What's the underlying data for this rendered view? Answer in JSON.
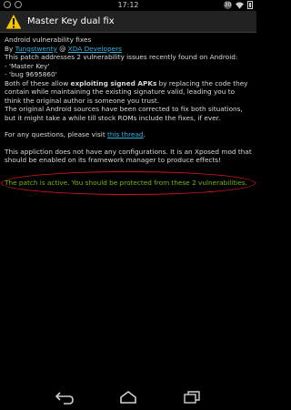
{
  "status_bar": {
    "time": "17:12",
    "notification_count": "30"
  },
  "action_bar": {
    "title": "Master Key dual fix"
  },
  "content": {
    "heading": "Android vulnerability fixes",
    "byline_prefix": "By",
    "author_link": "Tungstwenty",
    "byline_at": "@",
    "site_link": "XDA Developers",
    "para1_line1": "This patch addresses 2 vulnerability issues recently found on Android:",
    "para1_line2": "- 'Master Key'",
    "para1_line3": "- 'bug 9695860'",
    "para1_both_prefix": "Both of these allow",
    "para1_bold": "exploiting signed APKs",
    "para1_rest": "by replacing the code they contain while maintaining the existing signature valid, leading you to think the original author is someone you trust.",
    "para1_last": "The original Android sources have been corrected to fix both situations, but it might take a while till stock ROMs include the fixes, if ever.",
    "questions_prefix": "For any questions, please visit",
    "thread_link": "this thread",
    "questions_suffix": ".",
    "xposed_note": "This appliction does not have any configurations. It is an Xposed mod that should be enabled on its framework manager to produce effects!",
    "status_message": "The patch is active. You should be protected from these 2 vulnerabilities."
  },
  "colors": {
    "link": "#33b5e5",
    "status_ok": "#7ab800",
    "annotation": "#d9141c",
    "action_bar": "#222222"
  },
  "icons": [
    "settings-icon",
    "wifi-icon",
    "battery-icon",
    "warning-icon",
    "back-icon",
    "home-icon",
    "recents-icon"
  ]
}
